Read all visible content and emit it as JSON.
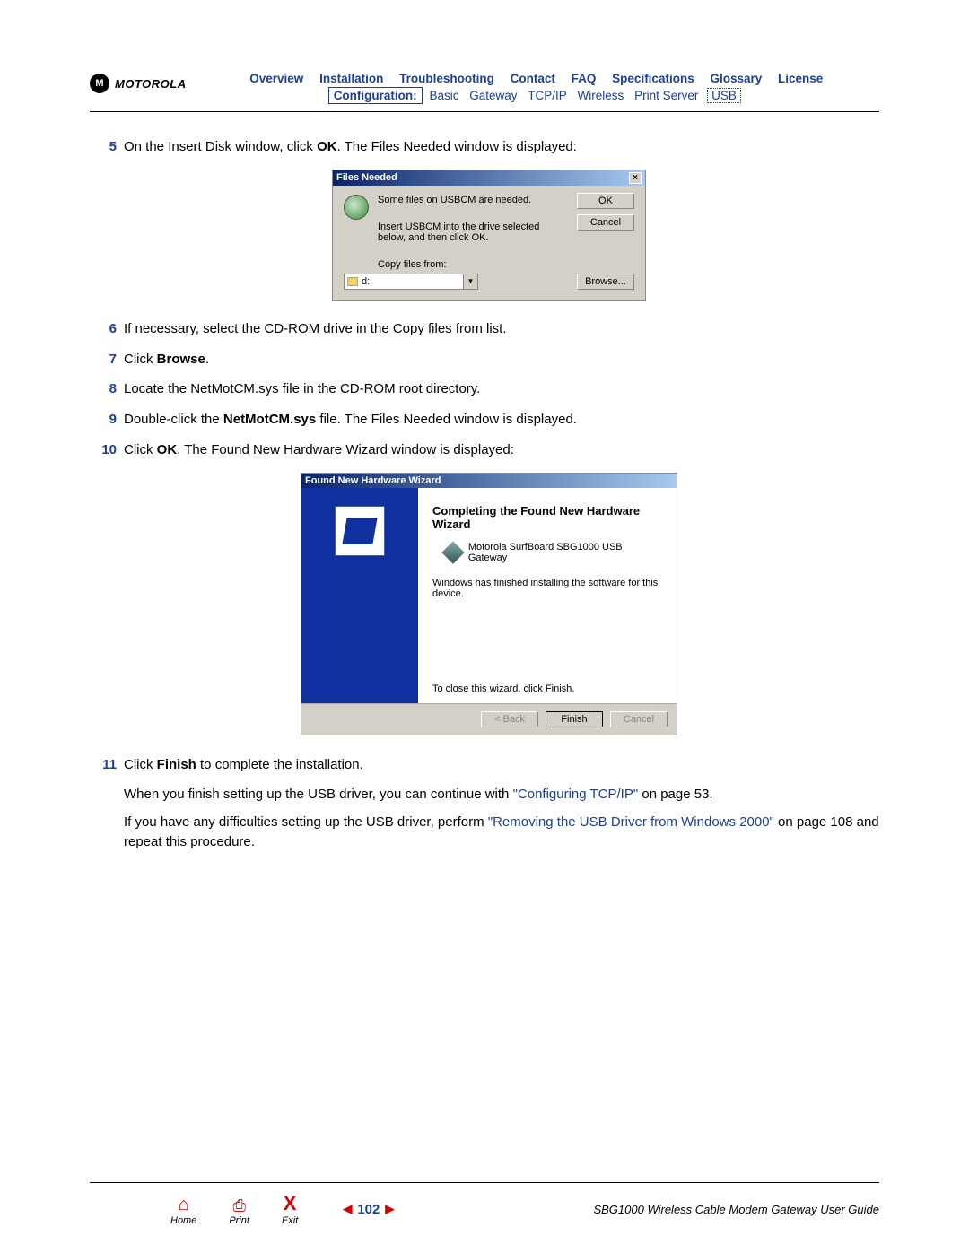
{
  "header": {
    "brand": "MOTOROLA",
    "nav_top": [
      "Overview",
      "Installation",
      "Troubleshooting",
      "Contact",
      "FAQ",
      "Specifications",
      "Glossary",
      "License"
    ],
    "config_label": "Configuration:",
    "nav_sub": [
      "Basic",
      "Gateway",
      "TCP/IP",
      "Wireless",
      "Print Server"
    ],
    "nav_sub_active": "USB"
  },
  "steps": {
    "s5": {
      "n": "5",
      "pre": "On the Insert Disk window, click ",
      "bold": "OK",
      "post": ". The Files Needed window is displayed:"
    },
    "s6": {
      "n": "6",
      "text": "If necessary, select the CD-ROM drive in the Copy files from list."
    },
    "s7": {
      "n": "7",
      "pre": "Click ",
      "bold": "Browse",
      "post": "."
    },
    "s8": {
      "n": "8",
      "text": "Locate the NetMotCM.sys file in the CD-ROM root directory."
    },
    "s9": {
      "n": "9",
      "pre": "Double-click the ",
      "bold": "NetMotCM.sys",
      "post": " file. The Files Needed window is displayed."
    },
    "s10": {
      "n": "10",
      "pre": "Click ",
      "bold": "OK",
      "post": ". The Found New Hardware Wizard window is displayed:"
    },
    "s11": {
      "n": "11",
      "pre": "Click ",
      "bold": "Finish",
      "post": " to complete the installation."
    }
  },
  "dialog1": {
    "title": "Files Needed",
    "msg1": "Some files on USBCM are needed.",
    "msg2": "Insert USBCM into the drive selected below, and then click OK.",
    "copy_label": "Copy files from:",
    "drive": "d:",
    "ok": "OK",
    "cancel": "Cancel",
    "browse": "Browse..."
  },
  "dialog2": {
    "title": "Found New Hardware Wizard",
    "heading": "Completing the Found New Hardware Wizard",
    "device": "Motorola SurfBoard SBG1000 USB Gateway",
    "done": "Windows has finished installing the software for this device.",
    "close": "To close this wizard, click Finish.",
    "back": "< Back",
    "finish": "Finish",
    "cancel": "Cancel"
  },
  "paras": {
    "p1_pre": "When you finish setting up the USB driver, you can continue with ",
    "p1_link": "\"Configuring TCP/IP\"",
    "p1_post": " on page 53.",
    "p2_pre": "If you have any difficulties setting up the USB driver, perform ",
    "p2_link": "\"Removing the USB Driver from Windows 2000\"",
    "p2_post": " on page 108 and repeat this procedure."
  },
  "footer": {
    "home": "Home",
    "print": "Print",
    "exit": "Exit",
    "page": "102",
    "guide": "SBG1000 Wireless Cable Modem Gateway User Guide"
  }
}
